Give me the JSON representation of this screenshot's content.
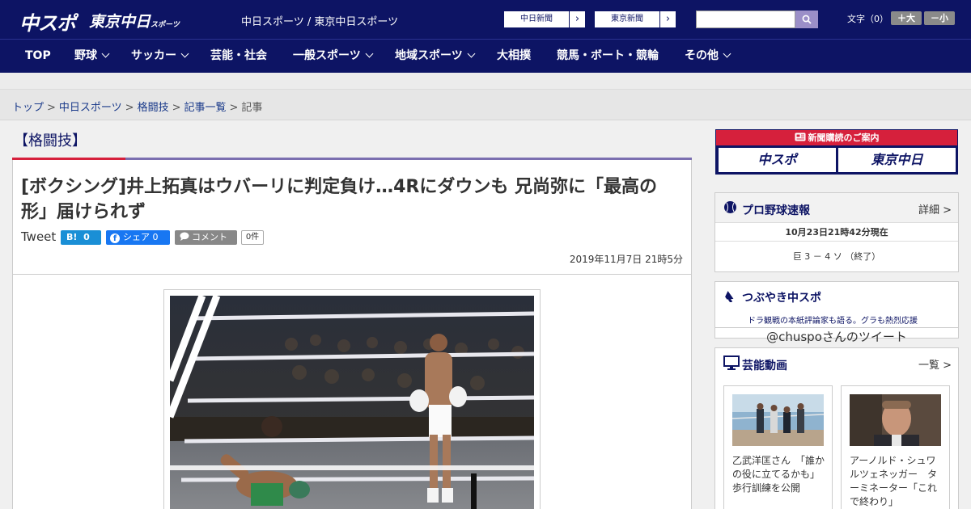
{
  "header": {
    "logo_chuspo": "中スポ",
    "logo_tokyo": "東京中日",
    "logo_tokyo_small": "スポーツ",
    "site_title": "中日スポーツ / 東京中日スポーツ",
    "ext_links": [
      {
        "label": "中日新聞",
        "arrow": "›"
      },
      {
        "label": "東京新聞",
        "arrow": "›"
      }
    ],
    "search_placeholder": "",
    "fontsize_label": "文字（0）",
    "font_larger": "＋大",
    "font_smaller": "－小"
  },
  "nav": {
    "items": [
      {
        "label": "TOP",
        "dropdown": false
      },
      {
        "label": "野球",
        "dropdown": true
      },
      {
        "label": "サッカー",
        "dropdown": true
      },
      {
        "label": "芸能・社会",
        "dropdown": false
      },
      {
        "label": "一般スポーツ",
        "dropdown": true
      },
      {
        "label": "地域スポーツ",
        "dropdown": true
      },
      {
        "label": "大相撲",
        "dropdown": false
      },
      {
        "label": "競馬・ボート・競輪",
        "dropdown": false
      },
      {
        "label": "その他",
        "dropdown": true
      }
    ]
  },
  "breadcrumb": {
    "items": [
      "トップ",
      "中日スポーツ",
      "格闘技",
      "記事一覧"
    ],
    "current": "記事",
    "separator": ">"
  },
  "article": {
    "category": "【格闘技】",
    "headline": "[ボクシング]井上拓真はウバーリに判定負け…4Rにダウンも 兄尚弥に「最高の形」届けられず",
    "tweet_label": "Tweet",
    "hatena_label": "B!",
    "hatena_count": "0",
    "fb_icon": "f",
    "fb_label": "シェア",
    "fb_count": "0",
    "comment_label": "コメント",
    "comment_count": "0件",
    "published": "2019年11月7日 21時5分"
  },
  "sidebar": {
    "subscribe_title": "新聞購読のご案内",
    "subscribe_logos": [
      "中スポ",
      "東京中日"
    ],
    "baseball": {
      "title": "プロ野球速報",
      "more": "詳細 >",
      "as_of": "10月23日21時42分現在",
      "score": "巨 3 － 4 ソ （終了）"
    },
    "tweets": {
      "title": "つぶやき中スポ",
      "subtitle": "ドラ観戦の本紙評論家も語る。グラも熱烈応援",
      "handle": "@chuspoさんのツイート"
    },
    "videos": {
      "title": "芸能動画",
      "more": "一覧 >",
      "items": [
        {
          "caption": "乙武洋匡さん　「誰かの役に立てるかも」歩行訓練を公開"
        },
        {
          "caption": "アーノルド・シュワルツェネッガー　ターミネーター「これで終わり」"
        }
      ]
    }
  },
  "colors": {
    "navy": "#0d1464",
    "accent_red": "#d6203c",
    "accent_purple": "#7b6fb0",
    "hatena_blue": "#1a8fd6",
    "facebook_blue": "#1877f2"
  }
}
